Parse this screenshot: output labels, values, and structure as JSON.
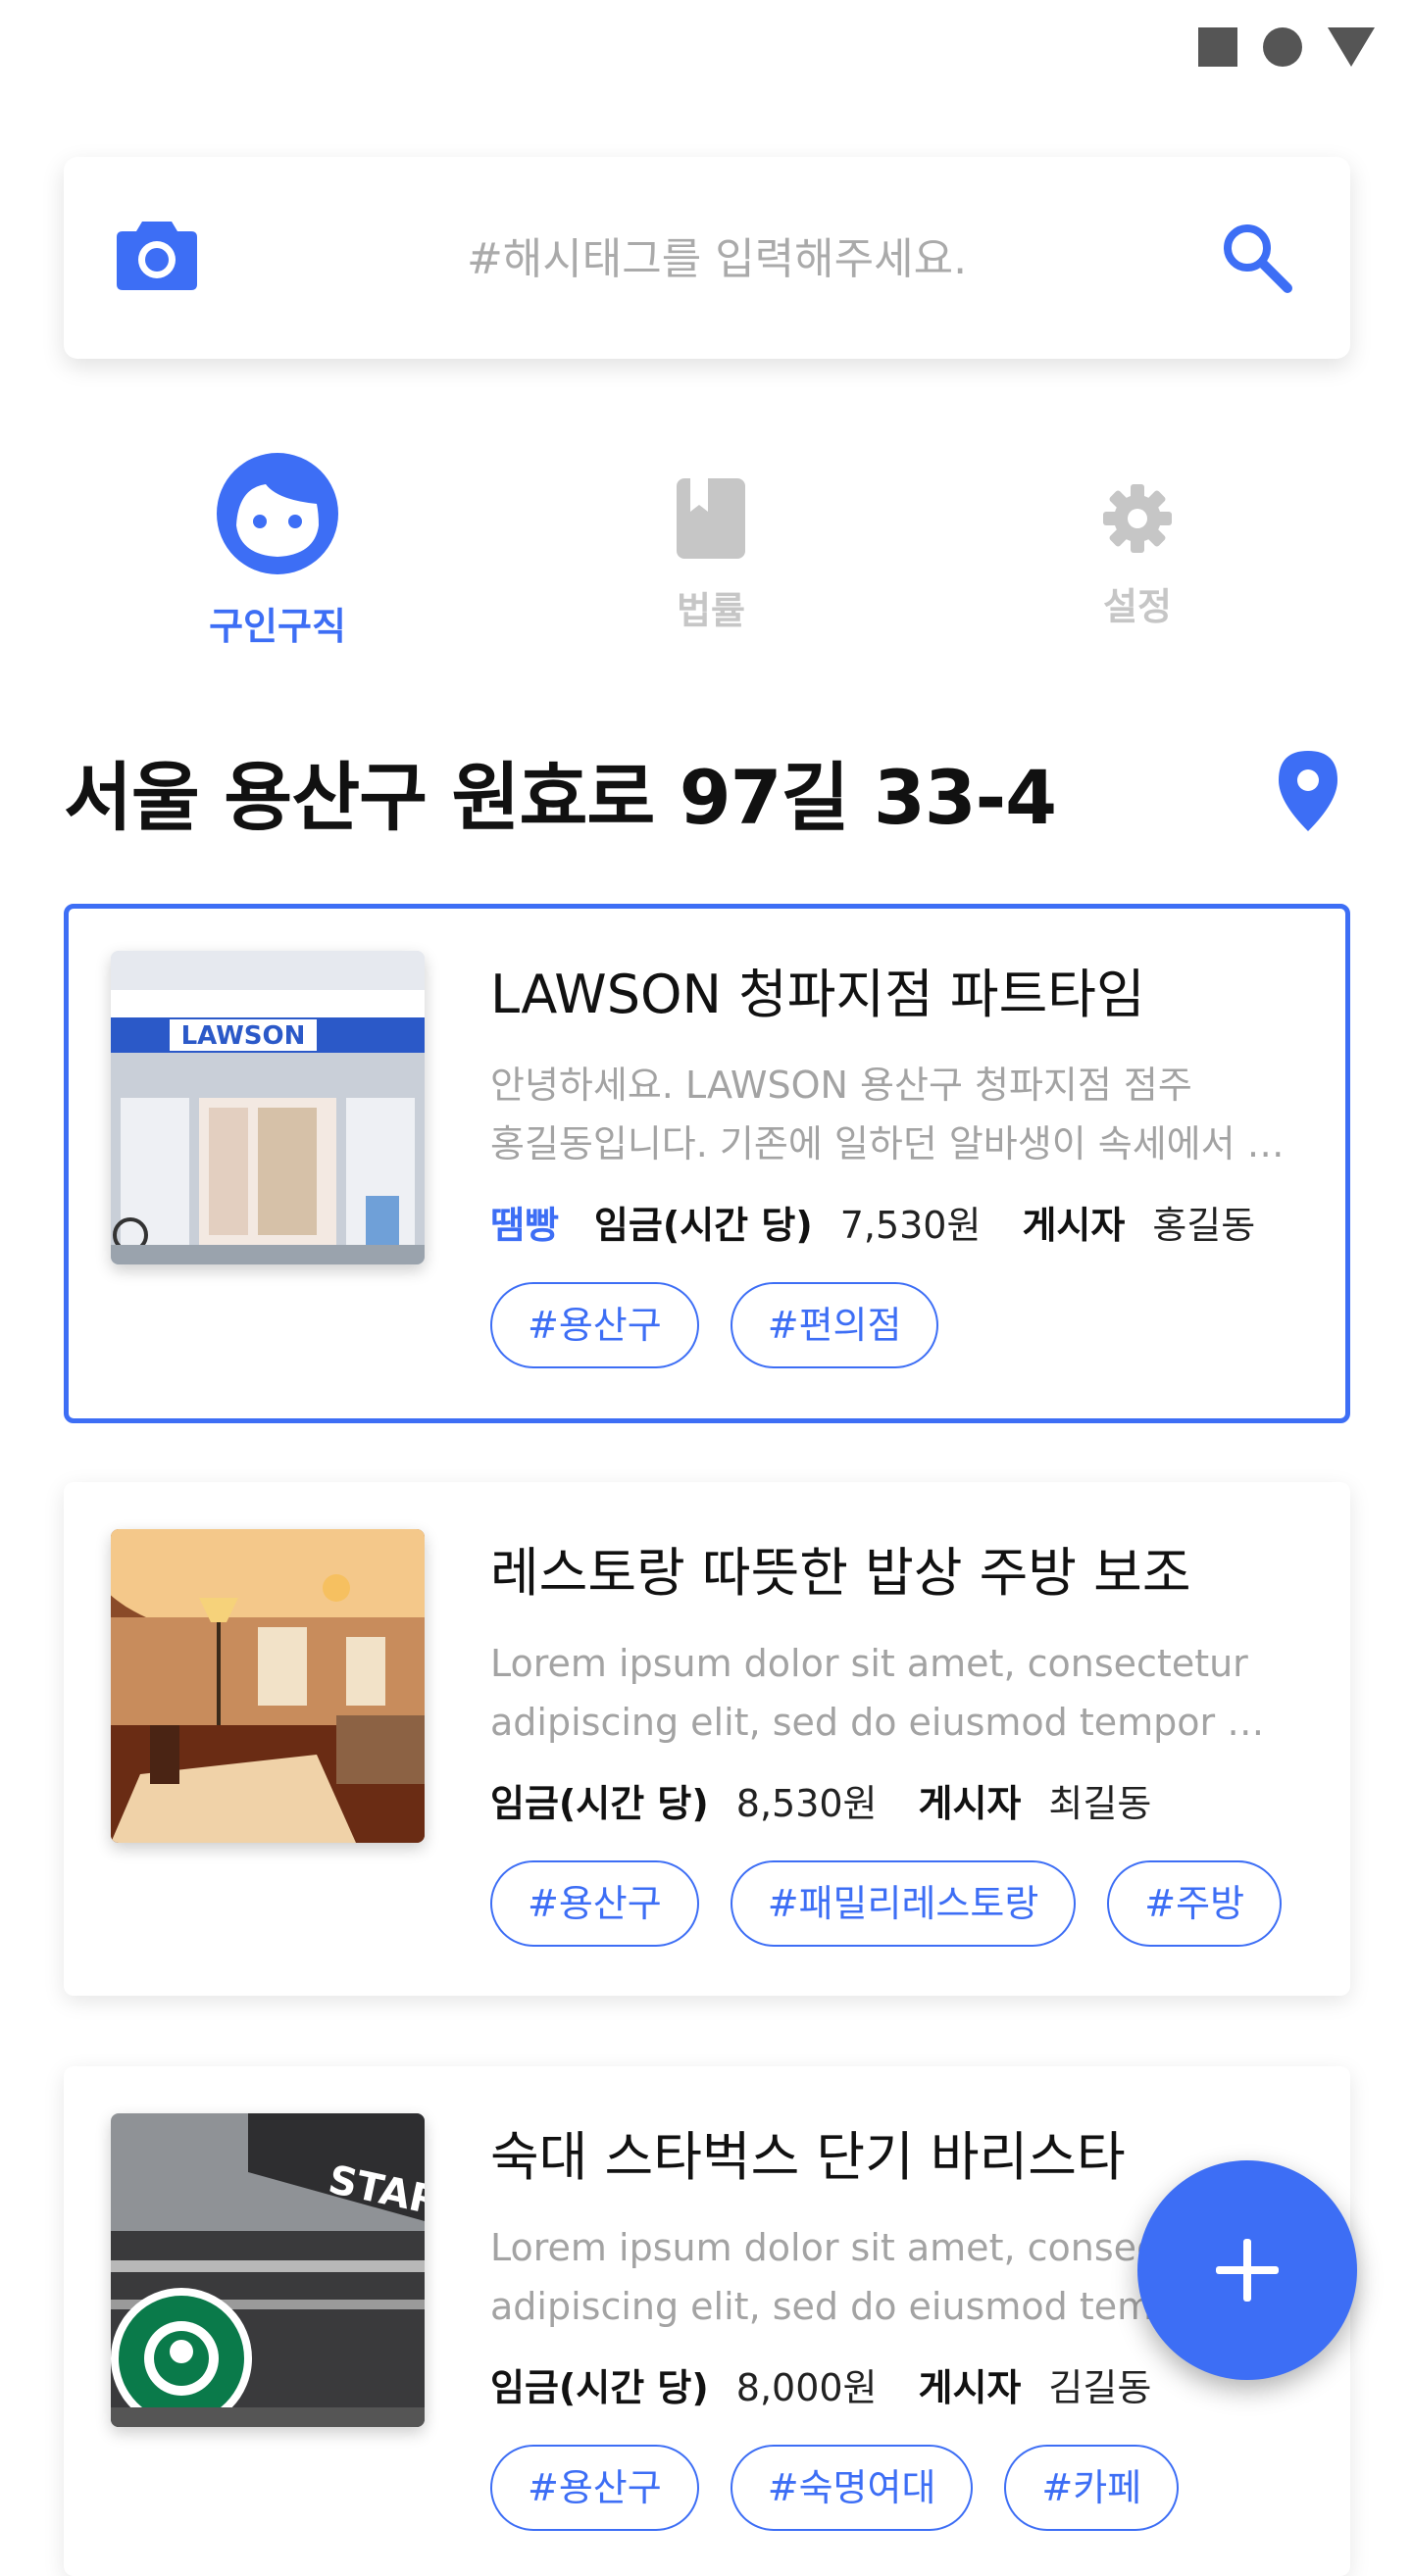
{
  "search": {
    "placeholder": "#해시태그를 입력해주세요."
  },
  "tabs": [
    {
      "label": "구인구직",
      "icon": "face-icon",
      "active": true
    },
    {
      "label": "법률",
      "icon": "book-icon",
      "active": false
    },
    {
      "label": "설정",
      "icon": "gear-icon",
      "active": false
    }
  ],
  "address": "서울 용산구 원효로 97길 33-4",
  "listings": [
    {
      "title": "LAWSON 청파지점 파트타임",
      "desc_line1": "안녕하세요. LAWSON 용산구 청파지점 점주",
      "desc_line2": "홍길동입니다. 기존에 일하던 알바생이 속세에서 …",
      "badge": "땜빵",
      "wage_label": "임금(시간 당)",
      "wage": "7,530원",
      "poster_label": "게시자",
      "poster": "홍길동",
      "tags": [
        "#용산구",
        "#편의점"
      ],
      "image": "convenience-store-photo",
      "store_sign": "LAWSON",
      "selected": true
    },
    {
      "title": "레스토랑 따뜻한 밥상 주방 보조",
      "desc_line1": "Lorem ipsum dolor sit amet, consectetur",
      "desc_line2": "adipiscing elit, sed do eiusmod tempor …",
      "wage_label": "임금(시간 당)",
      "wage": "8,530원",
      "poster_label": "게시자",
      "poster": "최길동",
      "tags": [
        "#용산구",
        "#패밀리레스토랑",
        "#주방"
      ],
      "image": "restaurant-interior-photo",
      "selected": false
    },
    {
      "title": "숙대 스타벅스 단기 바리스타",
      "desc_line1": "Lorem ipsum dolor sit amet, consec",
      "desc_line2": "adipiscing elit, sed do eiusmod temp",
      "wage_label": "임금(시간 당)",
      "wage": "8,000원",
      "poster_label": "게시자",
      "poster": "김길동",
      "tags": [
        "#용산구",
        "#숙명여대",
        "#카페"
      ],
      "image": "cafe-storefront-photo",
      "store_sign": "STARB",
      "selected": false
    }
  ],
  "colors": {
    "accent": "#3d6ef5",
    "muted_text": "#a3a3a3",
    "inactive_tab": "#c6c6c6"
  }
}
